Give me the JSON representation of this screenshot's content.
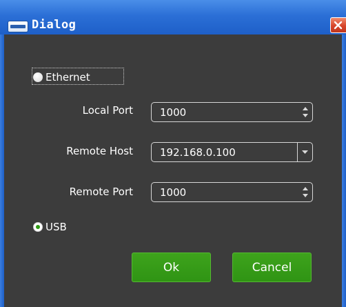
{
  "window": {
    "title": "Dialog"
  },
  "connection": {
    "ethernet_label": "Ethernet",
    "usb_label": "USB",
    "selected": "USB"
  },
  "fields": {
    "local_port_label": "Local Port",
    "local_port_value": "1000",
    "remote_host_label": "Remote Host",
    "remote_host_value": "192.168.0.100",
    "remote_port_label": "Remote Port",
    "remote_port_value": "1000"
  },
  "buttons": {
    "ok_label": "Ok",
    "cancel_label": "Cancel"
  },
  "colors": {
    "titlebar": "#2b6fd6",
    "background": "#3c3c3c",
    "button_green": "#34991a",
    "radio_checked": "#2f9b14",
    "close_red": "#d6452a"
  },
  "icons": {
    "title": "app-window-icon",
    "close": "close-icon",
    "spin": "spin-arrows-icon",
    "combo": "chevron-down-icon"
  }
}
